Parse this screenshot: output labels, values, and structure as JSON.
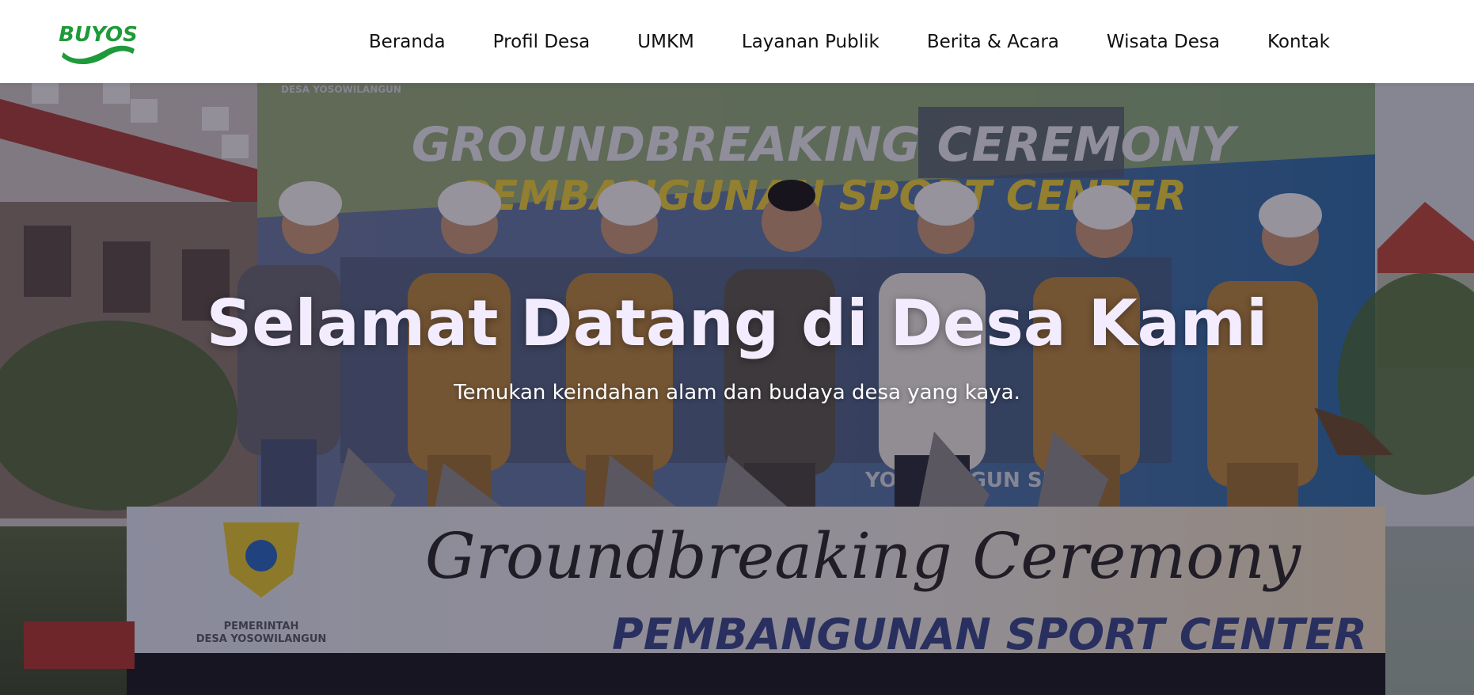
{
  "brand": {
    "logo_text": "BUYOS",
    "logo_color": "#1f9a3a"
  },
  "nav": {
    "items": [
      {
        "label": "Beranda"
      },
      {
        "label": "Profil Desa"
      },
      {
        "label": "UMKM"
      },
      {
        "label": "Layanan Publik"
      },
      {
        "label": "Berita & Acara"
      },
      {
        "label": "Wisata Desa"
      },
      {
        "label": "Kontak"
      }
    ]
  },
  "hero": {
    "title": "Selamat Datang di Desa Kami",
    "subtitle": "Temukan keindahan alam dan budaya desa yang kaya.",
    "title_color": "#f3ecff",
    "photo": {
      "backdrop_line1": "GROUNDBREAKING CEREMONY",
      "backdrop_line2": "PEMBANGUNAN SPORT CENTER",
      "backdrop_corner": "DESA YOSOWILANGUN",
      "backdrop_bottom": "YOSO ANGUN SEMB 2",
      "banner_script": "Groundbreaking Ceremony",
      "banner_title": "PEMBANGUNAN SPORT CENTER",
      "seal_line1": "PEMERINTAH",
      "seal_line2": "DESA YOSOWILANGUN"
    }
  }
}
